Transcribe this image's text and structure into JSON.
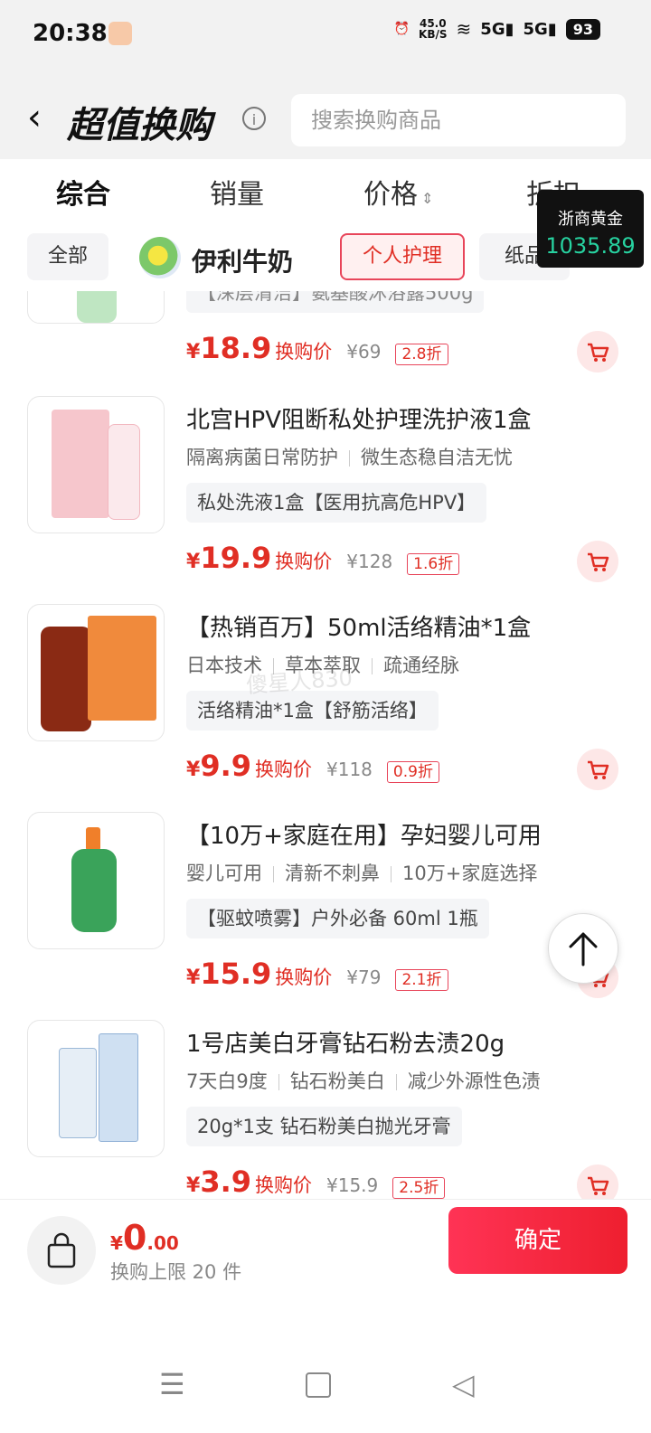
{
  "status": {
    "time": "20:38",
    "speed_top": "45.0",
    "speed_unit": "KB/S",
    "net1": "5G",
    "net2": "5G",
    "battery": "93"
  },
  "header": {
    "title": "超值换购",
    "search_placeholder": "搜索换购商品"
  },
  "sort_tabs": [
    "综合",
    "销量",
    "价格",
    "折扣"
  ],
  "sort_arrow": "⇕",
  "categories": {
    "all": "全部",
    "brand": "伊利牛奶",
    "selected": "个人护理",
    "next": "纸品"
  },
  "gold_ticker": {
    "label": "浙商黄金",
    "value": "1035.89"
  },
  "products": [
    {
      "name": "【深层清洁】氨基酸沐浴露500g",
      "price": "18.9",
      "price_label": "换购价",
      "original": "¥69",
      "discount": "2.8折"
    },
    {
      "name": "北宫HPV阻断私处护理洗护液1盒",
      "tags": [
        "隔离病菌日常防护",
        "微生态稳自洁无忧"
      ],
      "spec": "私处洗液1盒【医用抗高危HPV】",
      "price": "19.9",
      "price_label": "换购价",
      "original": "¥128",
      "discount": "1.6折"
    },
    {
      "name": "【热销百万】50ml活络精油*1盒",
      "tags": [
        "日本技术",
        "草本萃取",
        "疏通经脉"
      ],
      "spec": "活络精油*1盒【舒筋活络】",
      "price": "9.9",
      "price_label": "换购价",
      "original": "¥118",
      "discount": "0.9折"
    },
    {
      "name": "【10万+家庭在用】孕妇婴儿可用",
      "tags": [
        "婴儿可用",
        "清新不刺鼻",
        "10万+家庭选择"
      ],
      "spec": "【驱蚊喷雾】户外必备 60ml 1瓶",
      "price": "15.9",
      "price_label": "换购价",
      "original": "¥79",
      "discount": "2.1折"
    },
    {
      "name": "1号店美白牙膏钻石粉去渍20g",
      "tags": [
        "7天白9度",
        "钻石粉美白",
        "减少外源性色渍"
      ],
      "spec": "20g*1支 钻石粉美白抛光牙膏",
      "price": "3.9",
      "price_label": "换购价",
      "original": "¥15.9",
      "discount": "2.5折"
    }
  ],
  "footer": {
    "currency": "¥",
    "total_int": "0",
    "total_dec": ".00",
    "limit": "换购上限 20 件",
    "confirm": "确定"
  },
  "watermark": "傻星人830",
  "colors": {
    "accent": "#e02e24",
    "confirm_bg": "#ff3355",
    "ticker_value": "#27d2a0"
  }
}
